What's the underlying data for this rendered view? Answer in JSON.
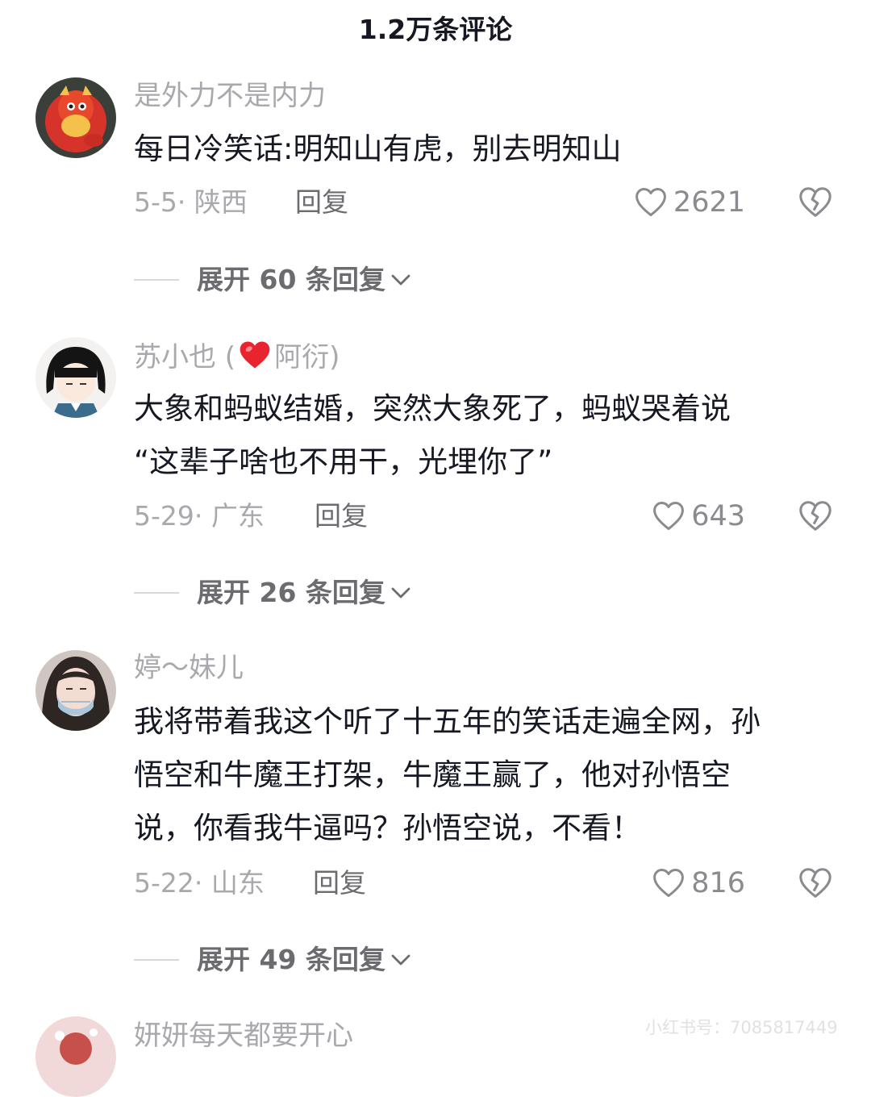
{
  "header": {
    "title": "1.2万条评论"
  },
  "comments": [
    {
      "username": "是外力不是内力",
      "content": [
        "每日冷笑话:明知山有虎，别去明知山"
      ],
      "meta": "5-5· 陕西",
      "reply": "回复",
      "likes": "2621",
      "expand": "展开 60 条回复"
    },
    {
      "username_before": "苏小也 (",
      "username_after": "阿衍)",
      "content": [
        "大象和蚂蚁结婚，突然大象死了，蚂蚁哭着说",
        "“这辈子啥也不用干，光埋你了”"
      ],
      "meta": "5-29· 广东",
      "reply": "回复",
      "likes": "643",
      "expand": "展开 26 条回复"
    },
    {
      "username": "婷～妹儿",
      "content": [
        "我将带着我这个听了十五年的笑话走遍全网，孙",
        "悟空和牛魔王打架，牛魔王赢了，他对孙悟空",
        "说，你看我牛逼吗？孙悟空说，不看！"
      ],
      "meta": "5-22· 山东",
      "reply": "回复",
      "likes": "816",
      "expand": "展开 49 条回复"
    },
    {
      "username": "妍妍每天都要开心"
    }
  ],
  "watermark": "小红书号：7085817449",
  "colors": {
    "heart_red": "#e8242f",
    "text_primary": "#161823",
    "text_secondary": "#a8a8ad"
  }
}
